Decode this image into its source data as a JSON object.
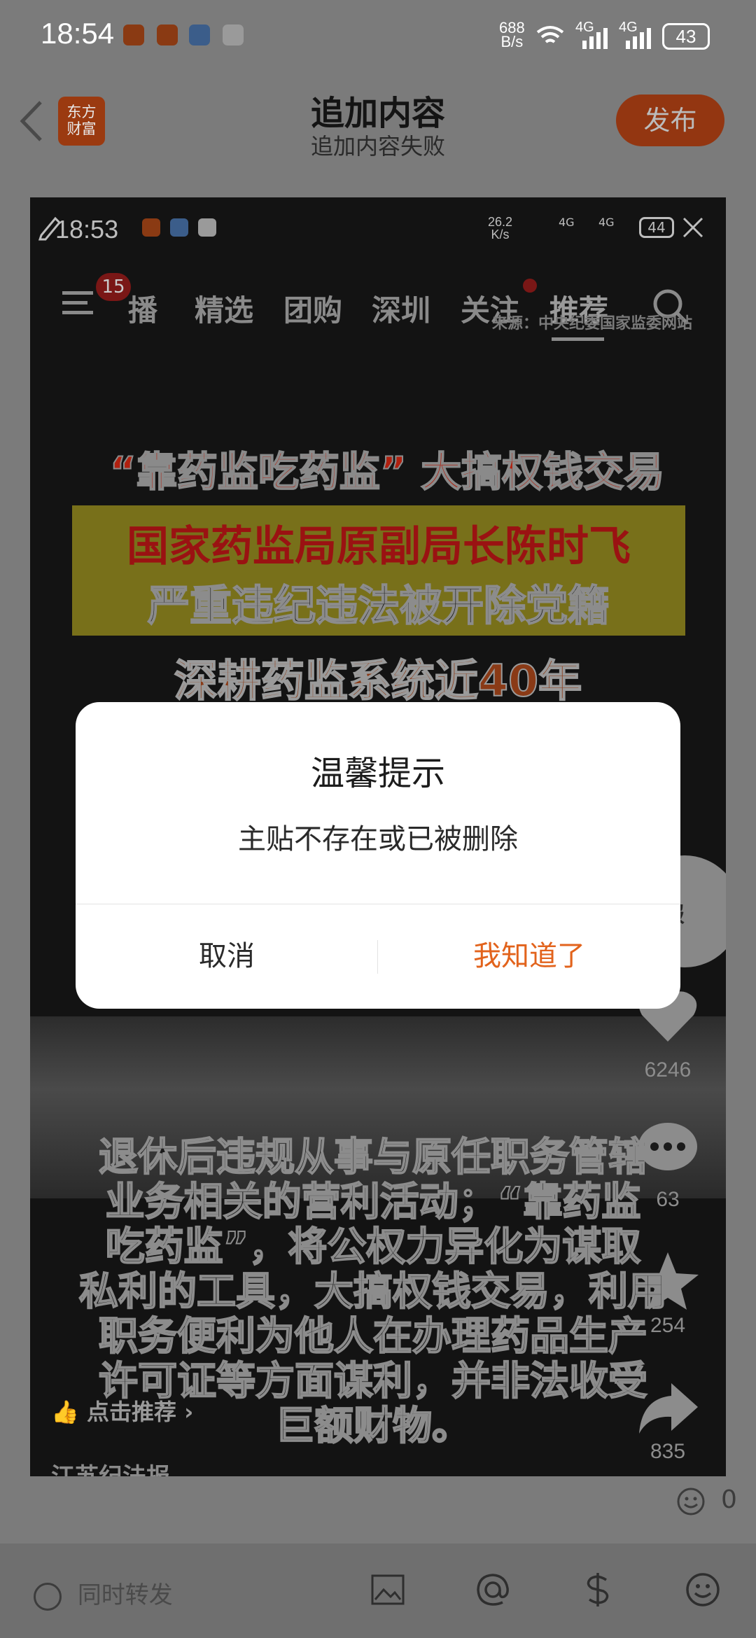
{
  "status_bar": {
    "time": "18:54",
    "net_speed_value": "688",
    "net_speed_unit": "B/s",
    "signal1": "4G",
    "signal2": "4G",
    "battery": "43"
  },
  "header": {
    "logo_text_line1": "东方",
    "logo_text_line2": "财富",
    "title": "追加内容",
    "subtitle": "追加内容失败",
    "publish_label": "发布"
  },
  "attachment": {
    "inner_status": {
      "time": "18:53",
      "net_speed_value": "26.2",
      "net_speed_unit": "K/s",
      "signal1": "4G",
      "signal2": "4G",
      "battery": "44"
    },
    "menu_badge": "15",
    "tabs": [
      "播",
      "精选",
      "团购",
      "深圳",
      "关注",
      "推荐"
    ],
    "source": "来源：中央纪委国家监委网站",
    "headline1": "“靠药监吃药监”  大搞权钱交易",
    "headline2": "国家药监局原副局长陈时飞",
    "headline3": "严重违纪违法被开除党籍",
    "headline4": "深耕药监系统近40年",
    "body_lines": [
      "退休后违规从事与原任职务管辖",
      "业务相关的营利活动；“靠药监",
      "吃药监”，将公权力异化为谋取",
      "私利的工具，大搞权钱交易，利用",
      "职务便利为他人在办理药品生产",
      "许可证等方面谋利，并非法收受",
      "巨额财物。"
    ],
    "avatar_text": "济报",
    "like_count": "6246",
    "comment_count": "63",
    "favorite_count": "254",
    "share_count": "835",
    "recommend_label": "点击推荐",
    "bottom_cut_text": "江苏纪法报"
  },
  "emoji_counter": "0",
  "bottom_bar": {
    "repost_label": "同时转发"
  },
  "dialog": {
    "title": "温馨提示",
    "message": "主贴不存在或已被删除",
    "cancel_label": "取消",
    "confirm_label": "我知道了"
  },
  "colors": {
    "accent": "#e2631c",
    "overlay": "#7b7b7b"
  }
}
